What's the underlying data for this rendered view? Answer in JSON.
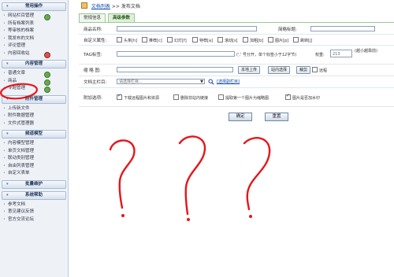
{
  "sidebar": {
    "sections": [
      {
        "title": "常用操作",
        "items": [
          {
            "label": "网站栏目管理",
            "badge": "green"
          },
          {
            "label": "所有档案列表",
            "badge": ""
          },
          {
            "label": "等审核的档案",
            "badge": ""
          },
          {
            "label": "我发布的文档",
            "badge": ""
          },
          {
            "label": "评论管理",
            "badge": ""
          },
          {
            "label": "内容回收站",
            "badge": "red"
          }
        ]
      },
      {
        "title": "内容管理",
        "items": [
          {
            "label": "普通文章",
            "badge": "green"
          },
          {
            "label": "商品",
            "badge": "green"
          },
          {
            "label": "专题管理",
            "badge": "green"
          }
        ]
      },
      {
        "title": "附件管理",
        "items": [
          {
            "label": "上传新文件",
            "badge": ""
          },
          {
            "label": "附件数据管理",
            "badge": ""
          },
          {
            "label": "文件式管理器",
            "badge": ""
          }
        ]
      },
      {
        "title": "频道模型",
        "items": [
          {
            "label": "内容模型管理",
            "badge": ""
          },
          {
            "label": "单页文档管理",
            "badge": ""
          },
          {
            "label": "联动类别管理",
            "badge": ""
          },
          {
            "label": "自由列表管理",
            "badge": ""
          },
          {
            "label": "自定义表单",
            "badge": ""
          }
        ]
      },
      {
        "title": "批量维护",
        "items": []
      },
      {
        "title": "系统帮助",
        "items": [
          {
            "label": "参考文档",
            "badge": ""
          },
          {
            "label": "意见建议反馈",
            "badge": ""
          },
          {
            "label": "官方交流论坛",
            "badge": ""
          }
        ]
      }
    ]
  },
  "breadcrumb": {
    "link": "文档列表",
    "sep": ">>",
    "current": "发布文档"
  },
  "tabs": [
    {
      "label": "常规信息",
      "active": false
    },
    {
      "label": "高级参数",
      "active": true
    }
  ],
  "form": {
    "title_label": "商品名称:",
    "short_title_label": "简略标题:",
    "attr_label": "自定义属性:",
    "attrs": [
      {
        "label": "头条[h]",
        "checked": false
      },
      {
        "label": "推荐[c]",
        "checked": false
      },
      {
        "label": "幻灯[f]",
        "checked": false
      },
      {
        "label": "特荐[a]",
        "checked": false
      },
      {
        "label": "滚动[s]",
        "checked": false
      },
      {
        "label": "加粗[b]",
        "checked": false
      },
      {
        "label": "图片[p]",
        "checked": false
      },
      {
        "label": "跳转[j]",
        "checked": false
      }
    ],
    "tag_label": "TAG标签:",
    "tag_hint": "(',' 号分开，单个标签小于12字节)",
    "weight_label": "权重:",
    "weight_value": "213",
    "weight_hint": "(越小越靠前)",
    "thumb_label": "缩 略 图:",
    "local_upload": "本地上传",
    "site_select": "站内选择",
    "crop": "裁剪",
    "remote_label": "远程",
    "category_label": "文档主栏目:",
    "category_placeholder": "请选择栏目...",
    "category_link": "[选择副栏目]",
    "extra_label": "附加选项:",
    "extras": [
      {
        "label": "下载远程图片和资源",
        "checked": true
      },
      {
        "label": "删除非站内链接",
        "checked": false
      },
      {
        "label": "提取第一个图片为缩略图",
        "checked": false
      },
      {
        "label": "图片是否加水印",
        "checked": true
      }
    ],
    "confirm": "确定",
    "reset": "重置"
  },
  "colors": {
    "annotation": "#e8141a",
    "tab_border": "#9fc59a",
    "sidebar_bg": "#eef2f7"
  },
  "icons": [
    "home-icon",
    "search-icon",
    "dropdown-arrow-icon"
  ]
}
